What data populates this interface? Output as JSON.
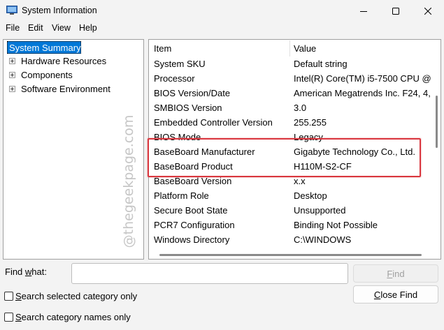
{
  "window": {
    "title": "System Information",
    "controls": [
      "minimize-icon",
      "maximize-icon",
      "close-icon"
    ]
  },
  "menu": {
    "items": [
      "File",
      "Edit",
      "View",
      "Help"
    ]
  },
  "tree": {
    "selected": "System Summary",
    "nodes": [
      "Hardware Resources",
      "Components",
      "Software Environment"
    ]
  },
  "list": {
    "columns": {
      "item": "Item",
      "value": "Value"
    },
    "rows": [
      {
        "item": "System SKU",
        "value": "Default string"
      },
      {
        "item": "Processor",
        "value": "Intel(R) Core(TM) i5-7500 CPU @"
      },
      {
        "item": "BIOS Version/Date",
        "value": "American Megatrends Inc. F24, 4,"
      },
      {
        "item": "SMBIOS Version",
        "value": "3.0"
      },
      {
        "item": "Embedded Controller Version",
        "value": "255.255"
      },
      {
        "item": "BIOS Mode",
        "value": "Legacy"
      },
      {
        "item": "BaseBoard Manufacturer",
        "value": "Gigabyte Technology Co., Ltd."
      },
      {
        "item": "BaseBoard Product",
        "value": "H110M-S2-CF"
      },
      {
        "item": "BaseBoard Version",
        "value": "x.x"
      },
      {
        "item": "Platform Role",
        "value": "Desktop"
      },
      {
        "item": "Secure Boot State",
        "value": "Unsupported"
      },
      {
        "item": "PCR7 Configuration",
        "value": "Binding Not Possible"
      },
      {
        "item": "Windows Directory",
        "value": "C:\\WINDOWS"
      }
    ]
  },
  "watermark": "@thegeekpage.com",
  "annotation": {
    "color": "#d9363e"
  },
  "accent": "#0078d7",
  "find": {
    "label_pre": "Find ",
    "label_ul": "w",
    "label_post": "hat:",
    "value": "",
    "find_button": {
      "ul": "F",
      "rest": "ind"
    },
    "close_button": {
      "ul": "C",
      "rest": "lose Find"
    },
    "option1": {
      "ul": "S",
      "rest": "earch selected category only",
      "checked": false
    },
    "option2": {
      "ul": "S",
      "rest": "earch category names only",
      "checked": false
    }
  }
}
